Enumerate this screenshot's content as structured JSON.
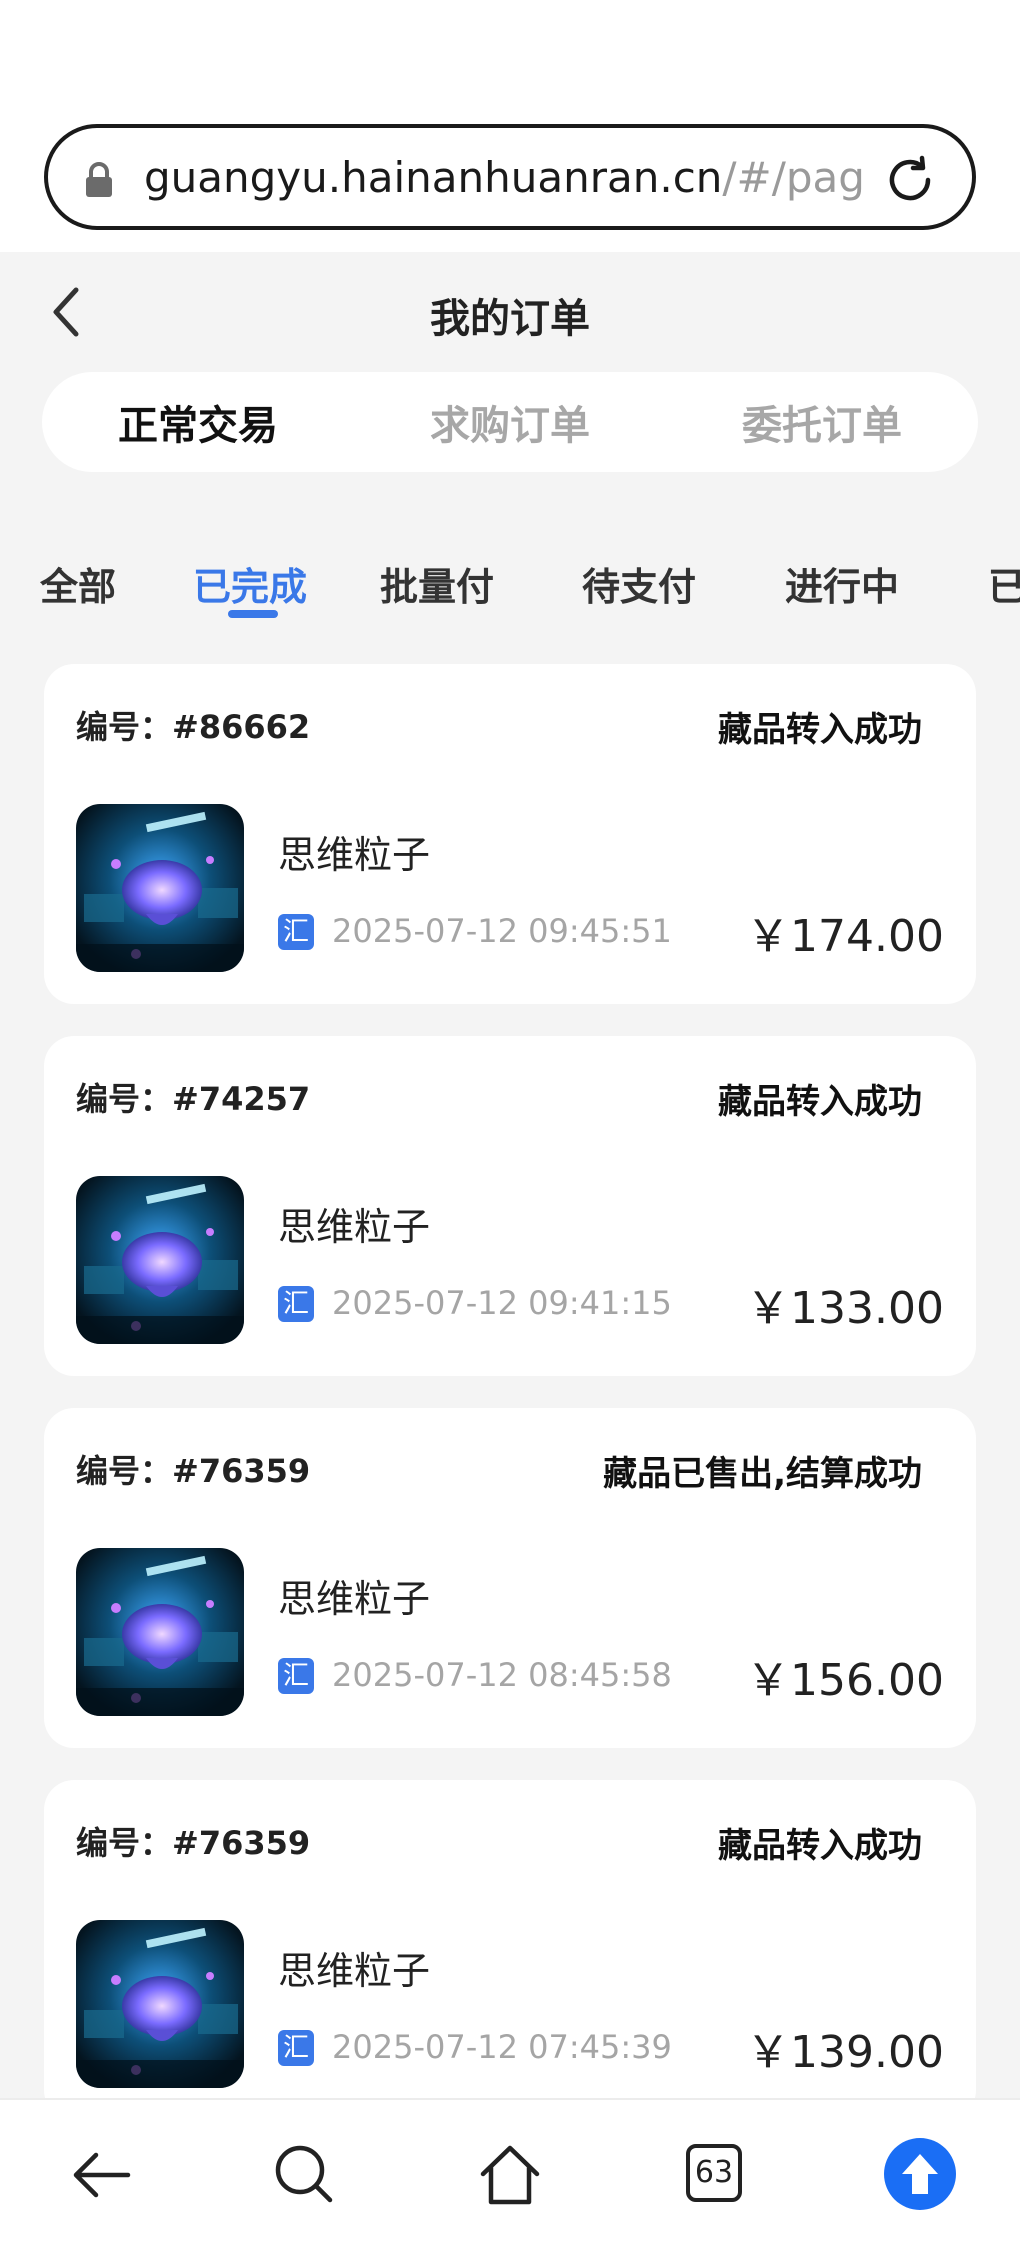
{
  "browser": {
    "url_main": "guangyu.hainanhuanran.cn",
    "url_dim": "/#/pages"
  },
  "header": {
    "title": "我的订单"
  },
  "segment_tabs": [
    {
      "label": "正常交易",
      "active": true
    },
    {
      "label": "求购订单",
      "active": false
    },
    {
      "label": "委托订单",
      "active": false
    }
  ],
  "status_tabs": [
    {
      "label": "全部",
      "active": false
    },
    {
      "label": "已完成",
      "active": true
    },
    {
      "label": "批量付",
      "active": false
    },
    {
      "label": "待支付",
      "active": false
    },
    {
      "label": "进行中",
      "active": false
    },
    {
      "label": "已",
      "active": false
    }
  ],
  "orders": [
    {
      "number": "编号：#86662",
      "status": "藏品转入成功",
      "name": "思维粒子",
      "pay_icon": "汇",
      "time": "2025-07-12 09:45:51",
      "price": "￥174.00"
    },
    {
      "number": "编号：#74257",
      "status": "藏品转入成功",
      "name": "思维粒子",
      "pay_icon": "汇",
      "time": "2025-07-12 09:41:15",
      "price": "￥133.00"
    },
    {
      "number": "编号：#76359",
      "status": "藏品已售出,结算成功",
      "name": "思维粒子",
      "pay_icon": "汇",
      "time": "2025-07-12 08:45:58",
      "price": "￥156.00"
    },
    {
      "number": "编号：#76359",
      "status": "藏品转入成功",
      "name": "思维粒子",
      "pay_icon": "汇",
      "time": "2025-07-12 07:45:39",
      "price": "￥139.00"
    }
  ],
  "bottom_nav": {
    "tabs_count": "63"
  },
  "colors": {
    "accent": "#3a78e8",
    "background": "#f4f4f4"
  }
}
